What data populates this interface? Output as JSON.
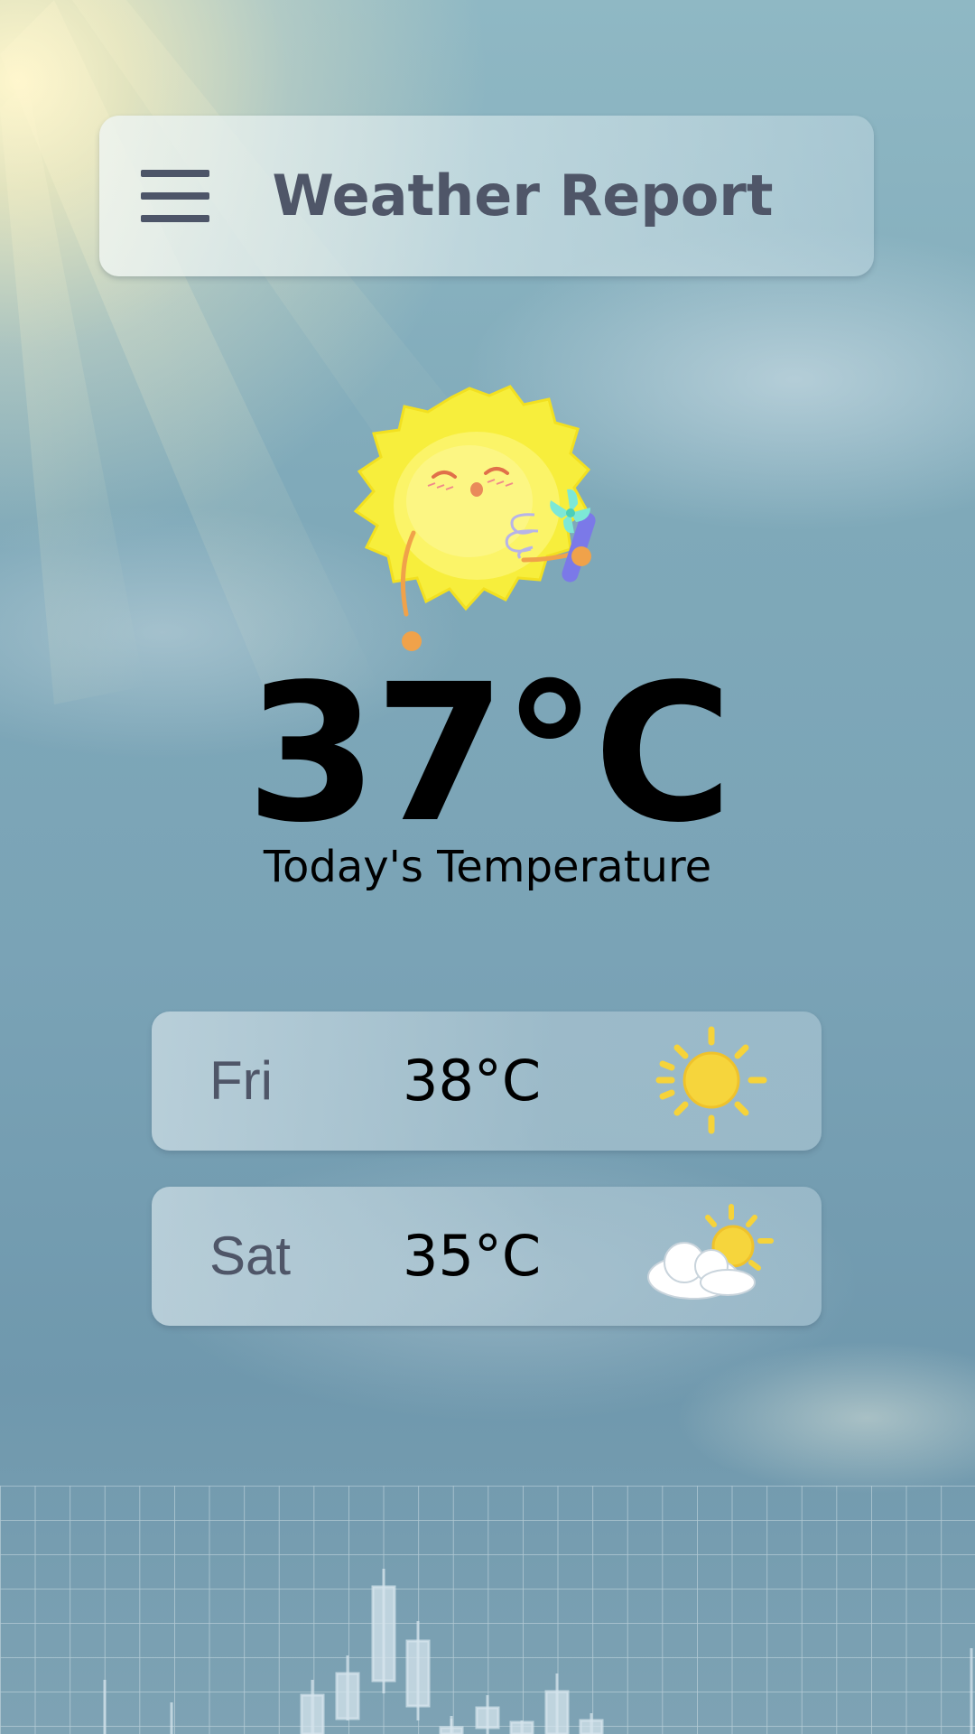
{
  "header": {
    "title": "Weather Report",
    "menu_icon": "hamburger-menu-icon"
  },
  "current": {
    "temperature": "37°C",
    "label": "Today's Temperature",
    "illustration": "hot-sun-with-fan-icon"
  },
  "forecast": [
    {
      "day": "Fri",
      "temp": "38°C",
      "icon": "sunny-icon"
    },
    {
      "day": "Sat",
      "temp": "35°C",
      "icon": "partly-cloudy-icon"
    }
  ],
  "colors": {
    "header_text": "#4f5668",
    "temperature_text": "#000000",
    "sun_yellow": "#f7e94a"
  },
  "decor": {
    "background_chart": "candlestick-chart-decoration"
  }
}
